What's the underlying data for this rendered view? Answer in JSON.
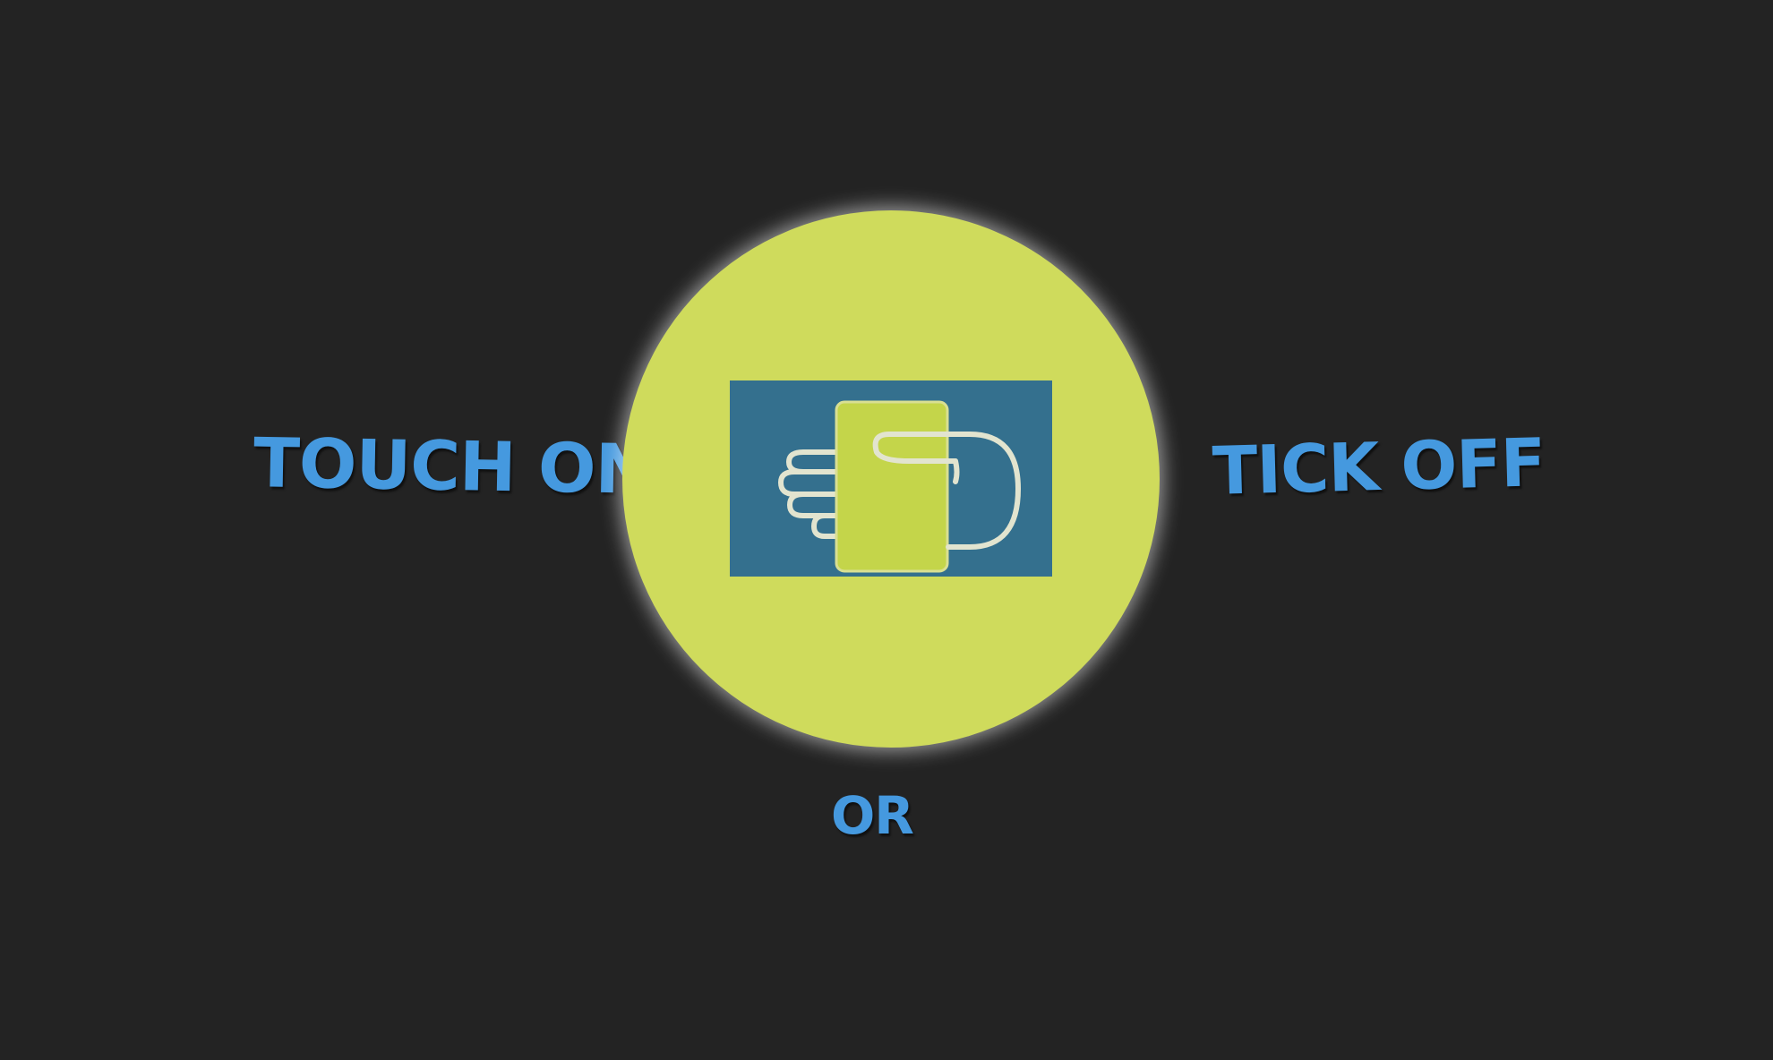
{
  "labels": {
    "touch_on": "TOUCH ON",
    "or": "OR",
    "tick_off": "TICK OFF"
  },
  "icons": {
    "center": "hand-card-tap-icon"
  },
  "colors": {
    "background": "#232323",
    "accent_text": "#4599df",
    "circle": "#cfdb5c",
    "icon_tile": "#34708e",
    "card": "#c4d54a",
    "hand_outline": "#e2e4cf"
  }
}
